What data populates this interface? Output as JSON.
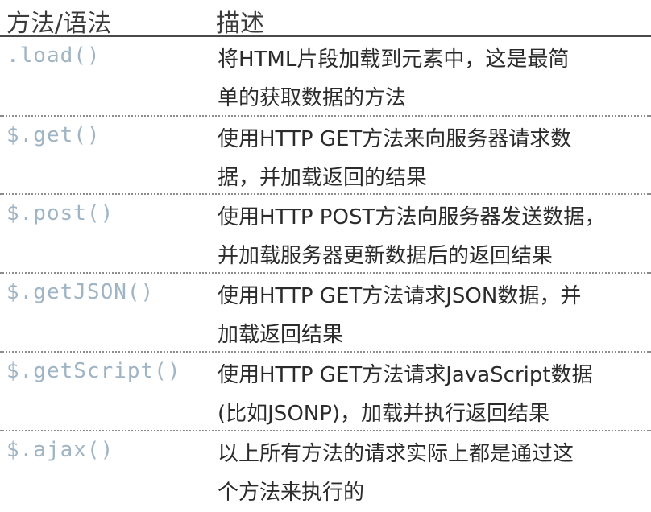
{
  "table": {
    "headers": {
      "method": "方法/语法",
      "description": "描述"
    },
    "rows": [
      {
        "method": ".load()",
        "desc_line1": "将HTML片段加载到元素中，这是最简",
        "desc_line2": "单的获取数据的方法"
      },
      {
        "method": "$.get()",
        "desc_line1": "使用HTTP  GET方法来向服务器请求数",
        "desc_line2": "据，并加载返回的结果"
      },
      {
        "method": "$.post()",
        "desc_line1": "使用HTTP   POST方法向服务器发送数据，",
        "desc_line2": "并加载服务器更新数据后的返回结果"
      },
      {
        "method": "$.getJSON()",
        "desc_line1": "使用HTTP GET方法请求JSON数据，并",
        "desc_line2": "加载返回结果"
      },
      {
        "method": "$.getScript()",
        "desc_line1": "使用HTTP GET方法请求JavaScript数据",
        "desc_line2": "(比如JSONP)，加载并执行返回结果"
      },
      {
        "method": "$.ajax()",
        "desc_line1": "以上所有方法的请求实际上都是通过这",
        "desc_line2": "个方法来执行的"
      }
    ]
  },
  "colors": {
    "method_text": "#9fb4c4",
    "body_text": "#2b2b2b",
    "rule": "#8c8c8c"
  }
}
